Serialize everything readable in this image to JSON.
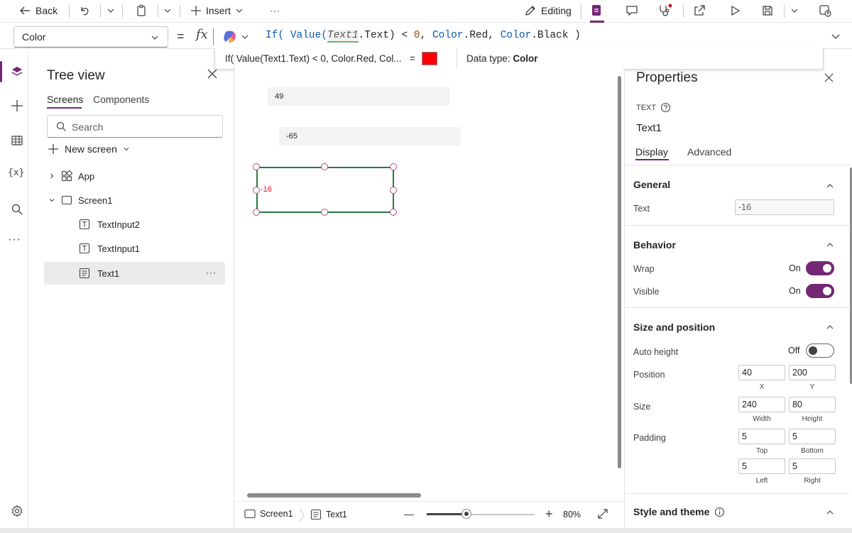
{
  "toolbar": {
    "back_label": "Back",
    "insert_label": "Insert",
    "more_label": "···",
    "editing_label": "Editing"
  },
  "formula_bar": {
    "property": "Color",
    "equals": "=",
    "fx": "fx",
    "formula": {
      "p1": "If( ",
      "f1": "Value",
      "p2": "(",
      "token": "Text1",
      "p3": ".Text) < ",
      "num": "0",
      "p4": ", ",
      "c1": "Color",
      "p5": ".Red, ",
      "c2": "Color",
      "p6": ".Black )"
    },
    "hint_expr": "If( Value(Text1.Text) < 0, Color.Red, Col...",
    "hint_eq": "=",
    "hint_color": "#ff0000",
    "data_type_label": "Data type:",
    "data_type_value": "Color"
  },
  "tree_view": {
    "title": "Tree view",
    "tabs": [
      "Screens",
      "Components"
    ],
    "search_placeholder": "Search",
    "new_screen_label": "New screen",
    "nodes": [
      {
        "label": "App"
      },
      {
        "label": "Screen1"
      },
      {
        "label": "TextInput2"
      },
      {
        "label": "TextInput1"
      },
      {
        "label": "Text1"
      }
    ],
    "more": "···"
  },
  "canvas": {
    "input2_value": "49",
    "input1_value": "-65",
    "text1_value": "-16",
    "text1_color": "#e81123",
    "selection_color": "#2b7a3b"
  },
  "status_bar": {
    "screen_label": "Screen1",
    "control_label": "Text1",
    "zoom_plus": "+",
    "zoom_value": "80%"
  },
  "properties": {
    "title": "Properties",
    "control_type": "TEXT",
    "control_name": "Text1",
    "tabs": [
      "Display",
      "Advanced"
    ],
    "general_title": "General",
    "text_label": "Text",
    "text_value": "-16",
    "behavior_title": "Behavior",
    "wrap_label": "Wrap",
    "wrap_state": "On",
    "visible_label": "Visible",
    "visible_state": "On",
    "size_title": "Size and position",
    "autoheight_label": "Auto height",
    "autoheight_state": "Off",
    "position_label": "Position",
    "pos_x": "40",
    "pos_y": "200",
    "x_cap": "X",
    "y_cap": "Y",
    "size_label": "Size",
    "width": "240",
    "height": "80",
    "width_cap": "Width",
    "height_cap": "Height",
    "padding_label": "Padding",
    "pad_top": "5",
    "pad_bottom": "5",
    "pad_left": "5",
    "pad_right": "5",
    "top_cap": "Top",
    "bottom_cap": "Bottom",
    "left_cap": "Left",
    "right_cap": "Right",
    "style_title": "Style and theme"
  },
  "colors": {
    "accent": "#742774",
    "tab_underline": "#742774"
  }
}
